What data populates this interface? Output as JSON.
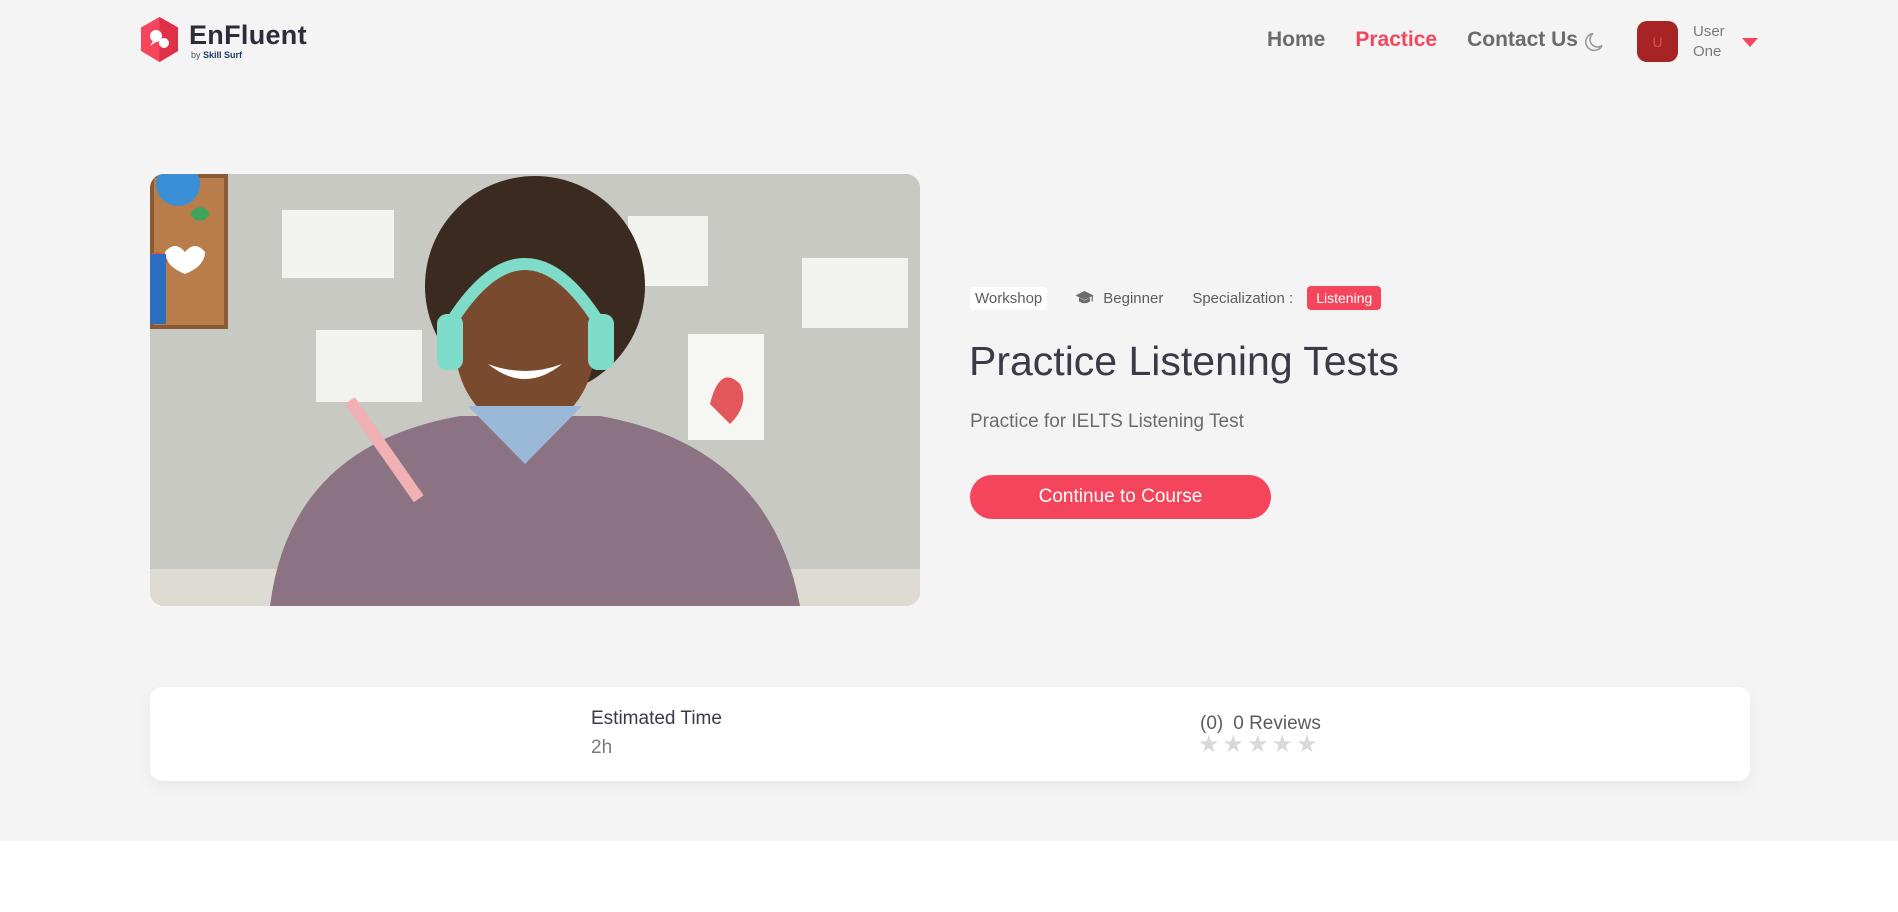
{
  "brand": {
    "name": "EnFluent",
    "by_prefix": "by",
    "by_name": "Skill Surf",
    "color": "#f4455c"
  },
  "nav": {
    "items": [
      {
        "label": "Home",
        "active": false
      },
      {
        "label": "Practice",
        "active": true
      },
      {
        "label": "Contact Us",
        "active": false
      }
    ],
    "theme_icon": "moon-icon"
  },
  "user": {
    "initial": "U",
    "name": "User One"
  },
  "course": {
    "type_tag": "Workshop",
    "level": "Beginner",
    "level_icon": "graduation-cap-icon",
    "specialization_label": "Specialization :",
    "specialization": "Listening",
    "title": "Practice Listening Tests",
    "subtitle": "Practice for IELTS Listening Test",
    "cta_label": "Continue to Course"
  },
  "stats": {
    "estimated_label": "Estimated Time",
    "estimated_value": "2h",
    "review_count": "(0)",
    "reviews_label": "0 Reviews",
    "rating": 0,
    "rating_max": 5
  }
}
